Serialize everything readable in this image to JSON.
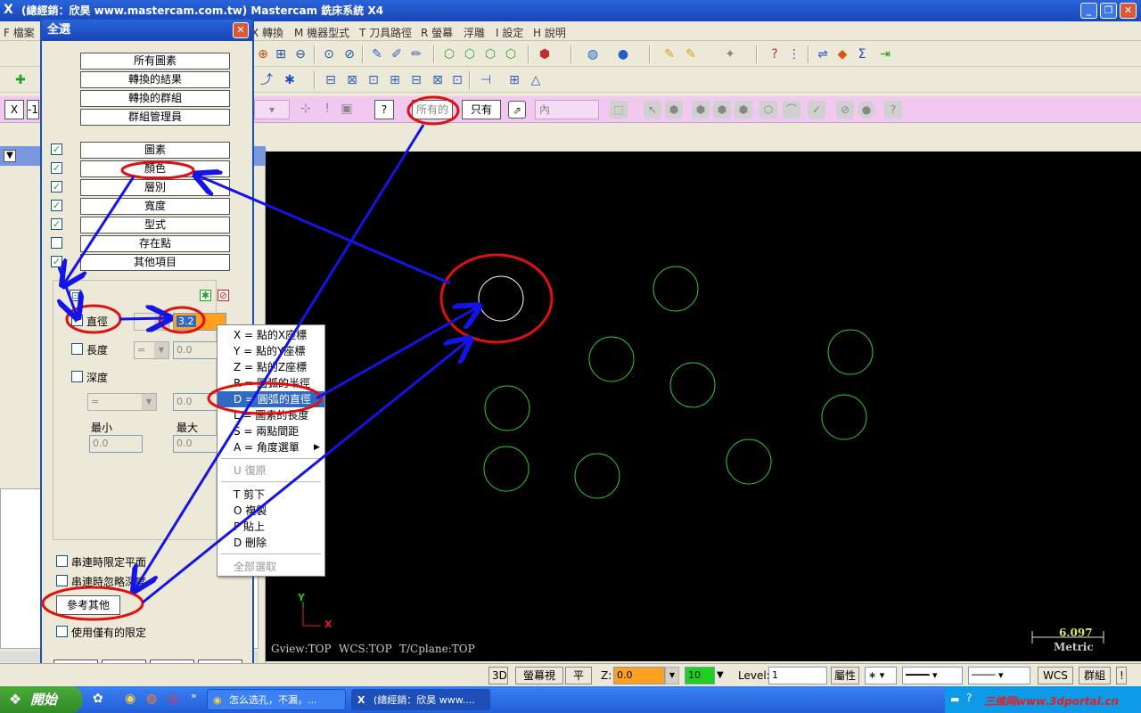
{
  "window": {
    "title": "(總經銷：欣昊 www.mastercam.com.tw) Mastercam 銑床系統 X4",
    "min": "_",
    "max": "❐",
    "close": "✕"
  },
  "menu": [
    "F 檔案",
    "X 轉換",
    "M 機器型式",
    "T 刀具路徑",
    "R 螢幕",
    "浮雕",
    "I 設定",
    "H 說明"
  ],
  "ribbon": {
    "x_label": "X",
    "x_value": "-1",
    "all_btn": "所有的",
    "only_btn": "只有",
    "inside_combo": "內"
  },
  "dialog": {
    "title": "全選",
    "top_buttons": [
      "所有圖素",
      "轉換的結果",
      "轉換的群組",
      "群組管理員"
    ],
    "filter_rows": [
      {
        "label": "圖素",
        "checked": true
      },
      {
        "label": "顏色",
        "checked": true
      },
      {
        "label": "層別",
        "checked": true
      },
      {
        "label": "寬度",
        "checked": true
      },
      {
        "label": "型式",
        "checked": true
      },
      {
        "label": "存在點",
        "checked": false
      },
      {
        "label": "其他項目",
        "checked": true
      }
    ],
    "diameter_label": "直徑",
    "diameter_value": "3.2",
    "length_label": "長度",
    "length_op": "=",
    "length_value": "0.0",
    "depth_label": "深度",
    "depth_op": "=",
    "depth_value": "0.0",
    "min_label": "最小",
    "max_label": "最大",
    "min_value": "0.0",
    "max_value": "0.0",
    "chain_limit_label": "串連時限定平面",
    "chain_ignore_label": "串連時忽略深度",
    "ref_other_btn": "參考其他",
    "use_only_label": "使用僅有的限定",
    "footer_icons": [
      "save-icon",
      "open-icon",
      "ok-check-icon",
      "help-icon"
    ]
  },
  "context_menu": [
    {
      "key": "X",
      "text": "X = 點的X座標"
    },
    {
      "key": "Y",
      "text": "Y = 點的Y座標"
    },
    {
      "key": "Z",
      "text": "Z = 點的Z座標"
    },
    {
      "key": "R",
      "text": "R = 圓弧的半徑"
    },
    {
      "key": "D",
      "text": "D = 圓弧的直徑"
    },
    {
      "key": "L",
      "text": "L = 圖素的長度"
    },
    {
      "key": "S",
      "text": "S = 兩點間距"
    },
    {
      "key": "A",
      "text": "A = 角度選單"
    },
    {
      "key": "U",
      "text": "U 復原"
    },
    {
      "key": "T",
      "text": "T 剪下"
    },
    {
      "key": "O",
      "text": "O 複製"
    },
    {
      "key": "P",
      "text": "P 貼上"
    },
    {
      "key": "Dd",
      "text": "D 刪除"
    },
    {
      "key": "SA",
      "text": "全部選取"
    }
  ],
  "viewport": {
    "gview": "Gview:TOP",
    "wcs": "WCS:TOP",
    "tcplane": "T/Cplane:TOP",
    "scale_value": "6.097",
    "scale_unit": "Metric",
    "axis_x": "X",
    "axis_y": "Y",
    "colors": {
      "background": "#000000",
      "circle": "#33cc33",
      "selected_circle": "#ffffff"
    }
  },
  "statusbar": {
    "btn_3d": "3D",
    "screen_view": "螢幕視角",
    "plane": "平面",
    "z_label": "Z:",
    "z_value": "0.0",
    "color_value": "10",
    "level_label": "Level:",
    "level_value": "1",
    "attr": "屬性",
    "wcs": "WCS",
    "group": "群組"
  },
  "taskbar": {
    "start": "開始",
    "tasks": [
      "怎么选孔，不漏，...",
      "(總經銷：欣昊 www...."
    ],
    "watermark": "三维网www.3dportal.cn",
    "time": "下午 02:35"
  }
}
